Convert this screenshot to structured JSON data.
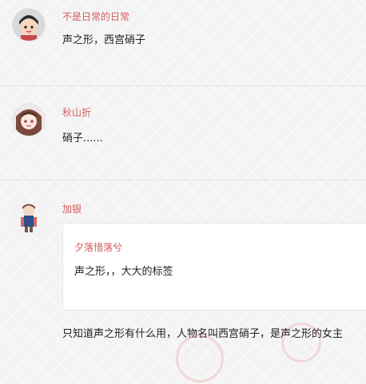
{
  "comments": [
    {
      "username": "不是日常的日常",
      "text": "声之形，西宫硝子"
    },
    {
      "username": "秋山折",
      "text": "硝子......"
    },
    {
      "username": "加银",
      "quote": {
        "username": "夕落惜落兮",
        "text": "声之形，，大大的标签"
      },
      "text": "只知道声之形有什么用，人物名叫西宫硝子，是声之形的女主"
    }
  ],
  "colors": {
    "username": "#d45b5b",
    "text": "#222222",
    "background": "#f4f3f3"
  }
}
